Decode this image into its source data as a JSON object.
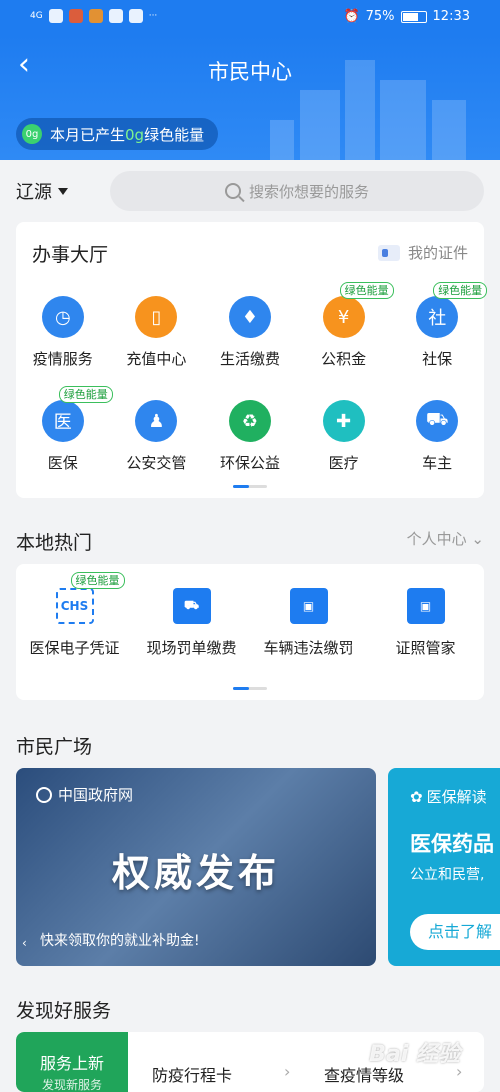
{
  "status_bar": {
    "network": "4G",
    "battery": "75%",
    "time": "12:33",
    "battery_level": 0.75
  },
  "header": {
    "title": "市民中心",
    "energy_prefix": "本月已产生",
    "energy_value": "0g",
    "energy_suffix": "绿色能量",
    "energy_icon_text": "0g"
  },
  "location": {
    "city": "辽源"
  },
  "search": {
    "placeholder": "搜索你想要的服务"
  },
  "hall": {
    "title": "办事大厅",
    "my_certs": "我的证件",
    "items": [
      {
        "label": "疫情服务",
        "icon": "clock-icon",
        "color": "#2f86ee",
        "badge": ""
      },
      {
        "label": "充值中心",
        "icon": "phone-icon",
        "color": "#f7931e",
        "badge": ""
      },
      {
        "label": "生活缴费",
        "icon": "water-drop-icon",
        "color": "#2f86ee",
        "badge": ""
      },
      {
        "label": "公积金",
        "icon": "house-yuan-icon",
        "color": "#f7931e",
        "badge": "绿色能量"
      },
      {
        "label": "社保",
        "icon": "shield-icon",
        "color": "#2f86ee",
        "badge": "绿色能量"
      },
      {
        "label": "医保",
        "icon": "medical-insurance-icon",
        "color": "#2f86ee",
        "badge": "绿色能量"
      },
      {
        "label": "公安交管",
        "icon": "police-icon",
        "color": "#2f86ee",
        "badge": ""
      },
      {
        "label": "环保公益",
        "icon": "recycle-icon",
        "color": "#20b060",
        "badge": ""
      },
      {
        "label": "医疗",
        "icon": "medical-icon",
        "color": "#1fbfc0",
        "badge": ""
      },
      {
        "label": "车主",
        "icon": "car-icon",
        "color": "#2f86ee",
        "badge": ""
      }
    ],
    "icon_glyphs": {
      "medical_insurance": "医",
      "social_security": "社",
      "fund": "¥"
    }
  },
  "local_hot": {
    "title": "本地热门",
    "personal_center": "个人中心",
    "items": [
      {
        "label": "医保电子凭证",
        "icon": "chs-icon",
        "glyph": "CHS",
        "badge": "绿色能量"
      },
      {
        "label": "现场罚单缴费",
        "icon": "car-ticket-icon",
        "glyph": "",
        "badge": ""
      },
      {
        "label": "车辆违法缴罚",
        "icon": "id-card-icon",
        "glyph": "",
        "badge": ""
      },
      {
        "label": "证照管家",
        "icon": "license-icon",
        "glyph": "",
        "badge": ""
      }
    ]
  },
  "plaza": {
    "title": "市民广场",
    "banner1": {
      "source": "中国政府网",
      "headline": "权威发布",
      "caption": "快来领取你的就业补助金!"
    },
    "banner2": {
      "source": "医保解读",
      "headline": "医保药品",
      "sub": "公立和民营,",
      "button": "点击了解"
    }
  },
  "discover": {
    "title": "发现好服务",
    "green_tag": "服务上新",
    "green_sub": "发现新服务",
    "items": [
      "防疫行程卡",
      "查疫情等级"
    ]
  },
  "watermark": "Bai 经验"
}
